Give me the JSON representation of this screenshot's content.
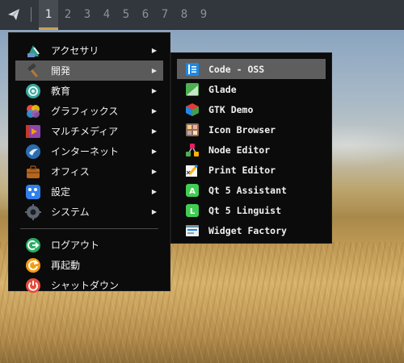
{
  "panel": {
    "workspaces": [
      "1",
      "2",
      "3",
      "4",
      "5",
      "6",
      "7",
      "8",
      "9"
    ],
    "active_workspace": "1"
  },
  "menu": {
    "items": [
      {
        "label": "アクセサリ",
        "icon": "accessories-icon",
        "submenu": true
      },
      {
        "label": "開発",
        "icon": "hammer-icon",
        "submenu": true,
        "highlighted": true
      },
      {
        "label": "教育",
        "icon": "education-icon",
        "submenu": true
      },
      {
        "label": "グラフィックス",
        "icon": "graphics-icon",
        "submenu": true
      },
      {
        "label": "マルチメディア",
        "icon": "multimedia-icon",
        "submenu": true
      },
      {
        "label": "インターネット",
        "icon": "internet-icon",
        "submenu": true
      },
      {
        "label": "オフィス",
        "icon": "office-icon",
        "submenu": true
      },
      {
        "label": "設定",
        "icon": "settings-icon",
        "submenu": true
      },
      {
        "label": "システム",
        "icon": "system-icon",
        "submenu": true
      }
    ],
    "session": [
      {
        "label": "ログアウト",
        "icon": "logout-icon"
      },
      {
        "label": "再起動",
        "icon": "reboot-icon"
      },
      {
        "label": "シャットダウン",
        "icon": "shutdown-icon"
      }
    ],
    "arrow_glyph": "▶"
  },
  "submenu": {
    "items": [
      {
        "label": "Code - OSS",
        "icon": "code-oss-icon",
        "highlighted": true
      },
      {
        "label": "Glade",
        "icon": "glade-icon"
      },
      {
        "label": "GTK Demo",
        "icon": "gtk-demo-icon"
      },
      {
        "label": "Icon Browser",
        "icon": "icon-browser-icon"
      },
      {
        "label": "Node Editor",
        "icon": "node-editor-icon"
      },
      {
        "label": "Print Editor",
        "icon": "print-editor-icon"
      },
      {
        "label": "Qt 5 Assistant",
        "icon": "qt-assistant-icon"
      },
      {
        "label": "Qt 5 Linguist",
        "icon": "qt-linguist-icon"
      },
      {
        "label": "Widget Factory",
        "icon": "widget-factory-icon"
      }
    ]
  },
  "colors": {
    "panel_bg": "#32373d",
    "menu_bg": "#0b0b0b",
    "highlight": "#5a5a5a",
    "active_underline": "#c9a05a"
  }
}
